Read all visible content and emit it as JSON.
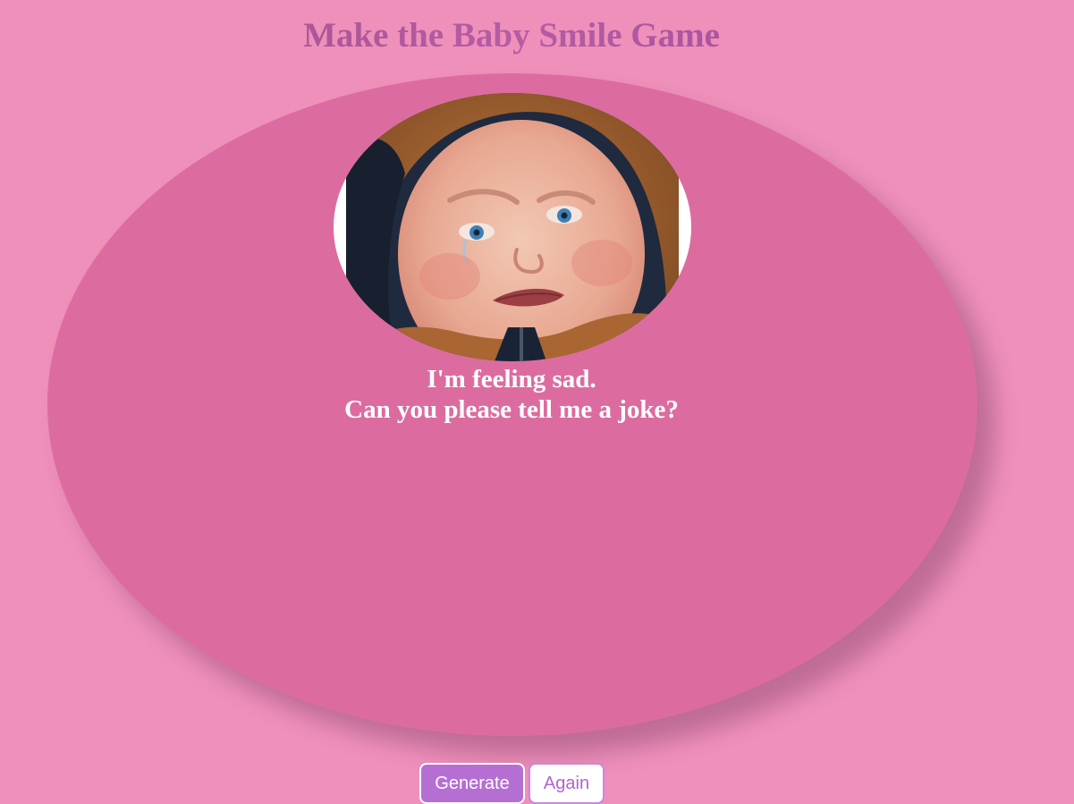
{
  "game": {
    "title": "Make the Baby Smile Game"
  },
  "baby": {
    "image_alt": "sad crying baby",
    "message_line1": "I'm feeling sad.",
    "message_line2": "Can you please tell me a joke?"
  },
  "controls": {
    "generate_label": "Generate",
    "again_label": "Again"
  },
  "colors": {
    "page_background": "#ef90bb",
    "oval_background": "#dc6c9f",
    "title_gradient": "#a04c86",
    "generate_button": "#b56fd3",
    "again_button_text": "#b164cd"
  }
}
